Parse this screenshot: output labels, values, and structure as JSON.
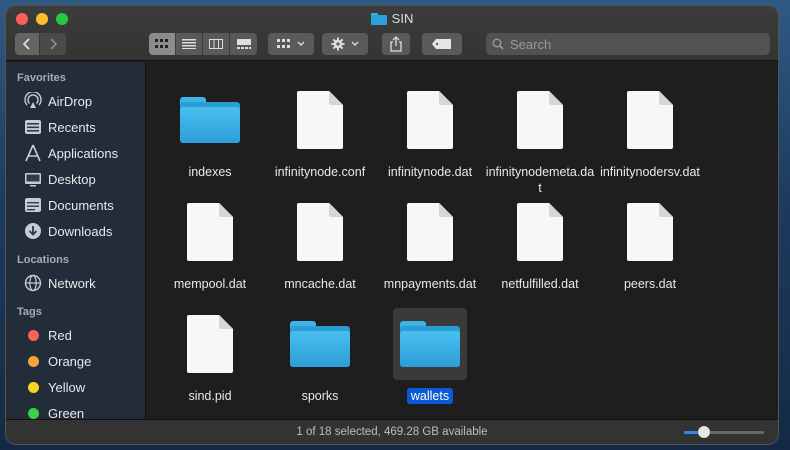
{
  "window": {
    "title": "SIN"
  },
  "toolbar": {
    "back_icon": "chevron-left-icon",
    "forward_icon": "chevron-right-icon",
    "views": [
      "icon-view",
      "list-view",
      "column-view",
      "gallery-view"
    ],
    "search_placeholder": "Search"
  },
  "sidebar": {
    "favorites_header": "Favorites",
    "favorites": [
      {
        "label": "AirDrop",
        "icon": "airdrop-icon"
      },
      {
        "label": "Recents",
        "icon": "clock-icon"
      },
      {
        "label": "Applications",
        "icon": "applications-icon"
      },
      {
        "label": "Desktop",
        "icon": "desktop-icon"
      },
      {
        "label": "Documents",
        "icon": "document-icon"
      },
      {
        "label": "Downloads",
        "icon": "download-icon"
      }
    ],
    "locations_header": "Locations",
    "locations": [
      {
        "label": "Network",
        "icon": "globe-icon"
      }
    ],
    "tags_header": "Tags",
    "tags": [
      {
        "label": "Red",
        "color": "#fe5f57"
      },
      {
        "label": "Orange",
        "color": "#f7a33a"
      },
      {
        "label": "Yellow",
        "color": "#f5d623"
      },
      {
        "label": "Green",
        "color": "#3bd14a"
      }
    ]
  },
  "files": [
    {
      "name": "indexes",
      "type": "folder"
    },
    {
      "name": "infinitynode.conf",
      "type": "document"
    },
    {
      "name": "infinitynode.dat",
      "type": "document"
    },
    {
      "name": "infinitynodemeta.dat",
      "type": "document"
    },
    {
      "name": "infinitynodersv.dat",
      "type": "document"
    },
    {
      "name": "mempool.dat",
      "type": "document"
    },
    {
      "name": "mncache.dat",
      "type": "document"
    },
    {
      "name": "mnpayments.dat",
      "type": "document"
    },
    {
      "name": "netfulfilled.dat",
      "type": "document"
    },
    {
      "name": "peers.dat",
      "type": "document"
    },
    {
      "name": "sind.pid",
      "type": "document"
    },
    {
      "name": "sporks",
      "type": "folder"
    },
    {
      "name": "wallets",
      "type": "folder",
      "selected": true
    }
  ],
  "status": {
    "text": "1 of 18 selected, 469.28 GB available",
    "zoom_level": 0.25
  }
}
